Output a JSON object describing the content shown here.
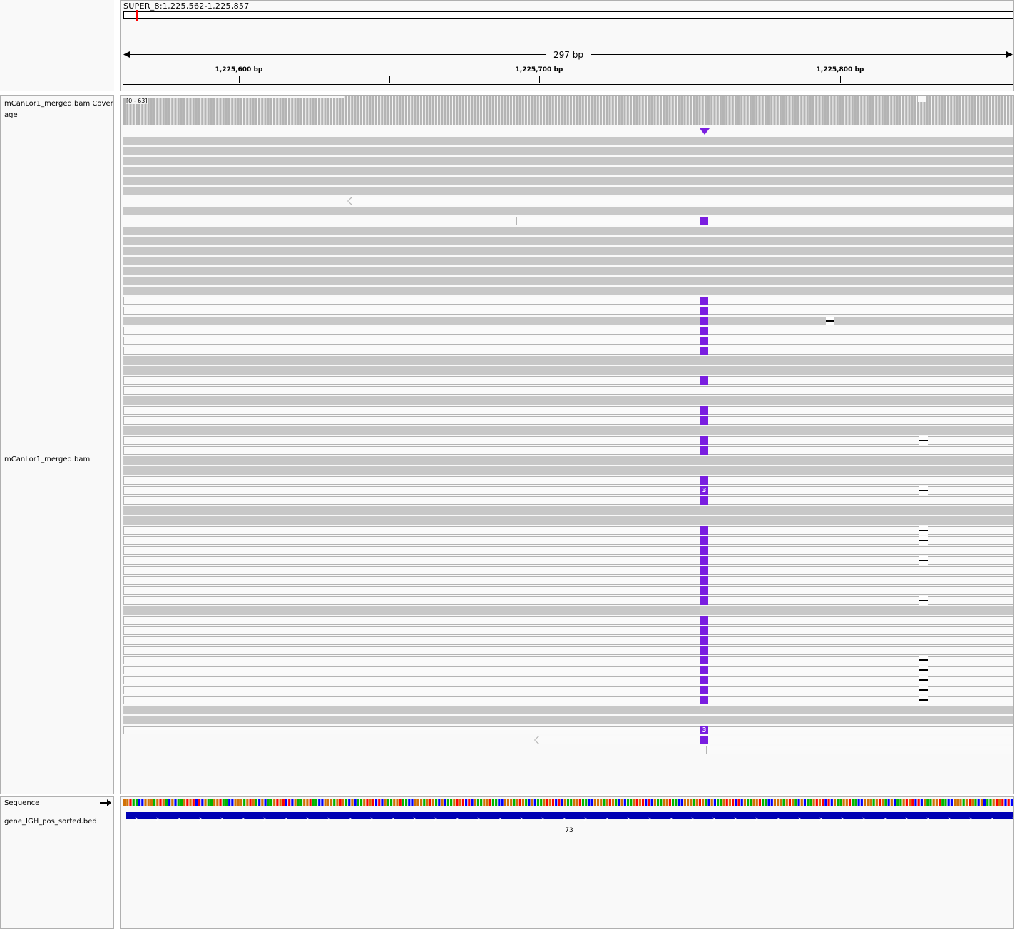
{
  "header": {
    "locus": "SUPER_8:1,225,562-1,225,857",
    "span_label": "297 bp",
    "ticks": [
      "1,225,600 bp",
      "1,225,700 bp",
      "1,225,800 bp"
    ]
  },
  "tracks": {
    "coverage_name": "mCanLor1_merged.bam Coverage",
    "coverage_range": "[0 - 63]",
    "alignment_name": "mCanLor1_merged.bam",
    "sequence_name": "Sequence",
    "bed_name": "gene_IGH_pos_sorted.bed",
    "feature_label": "73"
  },
  "insertion_counts": [
    "3",
    "3"
  ],
  "colors": {
    "insertion": "#7a1ee0",
    "coverage": "#b4b4b4",
    "read_gray": "#c8c8c8",
    "feature": "#0000b4",
    "base_a": "#00b400",
    "base_c": "#0000ff",
    "base_g": "#d17105",
    "base_t": "#ff0000"
  },
  "icons": {
    "strand_arrow": "right-arrow-icon",
    "insertion_marker": "triangle-down-icon"
  }
}
